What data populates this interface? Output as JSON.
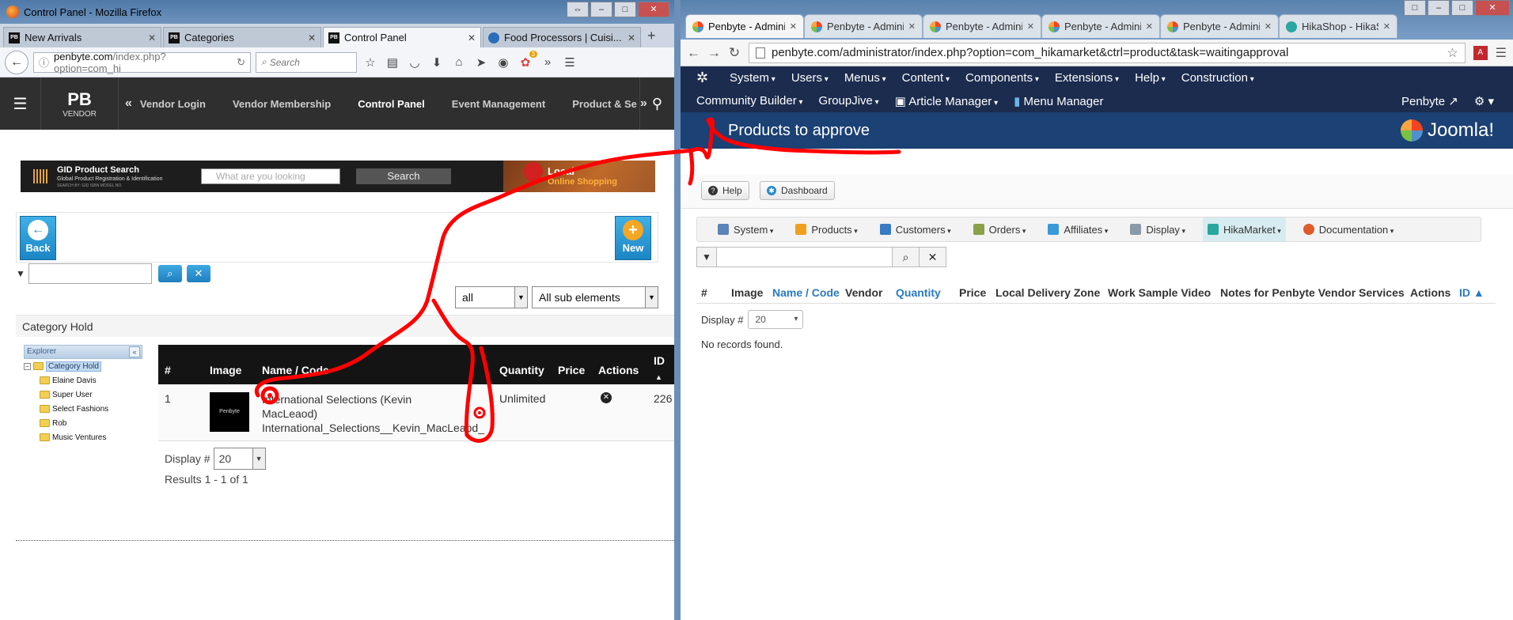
{
  "left_window": {
    "title": "Control Panel - Mozilla Firefox",
    "win_buttons": [
      "⇔",
      "–",
      "□",
      "✕"
    ],
    "tabs": [
      {
        "label": "New Arrivals",
        "icon": "PB"
      },
      {
        "label": "Categories",
        "icon": "PB"
      },
      {
        "label": "Control Panel",
        "icon": "PB",
        "active": true
      },
      {
        "label": "Food Processors | Cuisi...",
        "icon": "globe"
      }
    ],
    "url": "penbyte.com",
    "url_rest": "/index.php?option=com_hi",
    "search_placeholder": "Search",
    "badge": "3",
    "site_nav": {
      "logo": "PB",
      "logo_sub": "VENDOR",
      "items": [
        "Vendor Login",
        "Vendor Membership",
        "Control Panel",
        "Event Management",
        "Product & Se"
      ]
    },
    "banner": {
      "title": "GID Product Search",
      "subtitle": "Global Product Registration & Identification",
      "tagline": "SEARCH BY: GID ISBN MODEL NO.",
      "input_placeholder": "What are you looking",
      "button": "Search",
      "local": "Local",
      "online": "Online Shopping"
    },
    "toolbar": {
      "back": "Back",
      "new": "New"
    },
    "filter_sel1": "all",
    "filter_sel2": "All sub elements",
    "category_title": "Category Hold",
    "explorer": {
      "header": "Explorer",
      "root": "Category Hold",
      "children": [
        "Elaine Davis",
        "Super User",
        "Select Fashions",
        "Rob",
        "Music Ventures"
      ]
    },
    "grid": {
      "headers": [
        "#",
        "Image",
        "Name / Code",
        "Quantity",
        "Price",
        "Actions",
        "ID"
      ],
      "rows": [
        {
          "num": "1",
          "thumb": "Penbyte",
          "name": "International Selections (Kevin MacLeaod)",
          "code": "International_Selections__Kevin_MacLeaod_",
          "quantity": "Unlimited",
          "price": "",
          "id": "226"
        }
      ]
    },
    "display_label": "Display #",
    "display_value": "20",
    "results": "Results 1 - 1 of 1"
  },
  "right_window": {
    "tabs": [
      "Penbyte - Adminis",
      "Penbyte - Adminis",
      "Penbyte - Adminis",
      "Penbyte - Adminis",
      "Penbyte - Adminis",
      "HikaShop - HikaSl"
    ],
    "url": "penbyte.com/administrator/index.php?option=com_hikamarket&ctrl=product&task=waitingapproval",
    "menu_row1": [
      "System",
      "Users",
      "Menus",
      "Content",
      "Components",
      "Extensions",
      "Help",
      "Construction"
    ],
    "menu_row2": [
      "Community Builder",
      "GroupJive",
      "Article Manager",
      "Menu Manager"
    ],
    "user": "Penbyte",
    "page_title": "Products to approve",
    "brand": "Joomla!",
    "sub_buttons": [
      "Help",
      "Dashboard"
    ],
    "hika_menu": [
      "System",
      "Products",
      "Customers",
      "Orders",
      "Affiliates",
      "Display",
      "HikaMarket",
      "Documentation"
    ],
    "table_headers": [
      "#",
      "Image",
      "Name / Code",
      "Vendor",
      "Quantity",
      "Price",
      "Local Delivery Zone",
      "Work Sample Video",
      "Notes for Penbyte Vendor Services",
      "Actions",
      "ID ▲"
    ],
    "display_label": "Display #",
    "display_value": "20",
    "empty_message": "No records found."
  },
  "colors": {
    "annotation": "#ff0000",
    "joomla_dark": "#1b2c4e",
    "joomla_title": "#1b4175"
  }
}
